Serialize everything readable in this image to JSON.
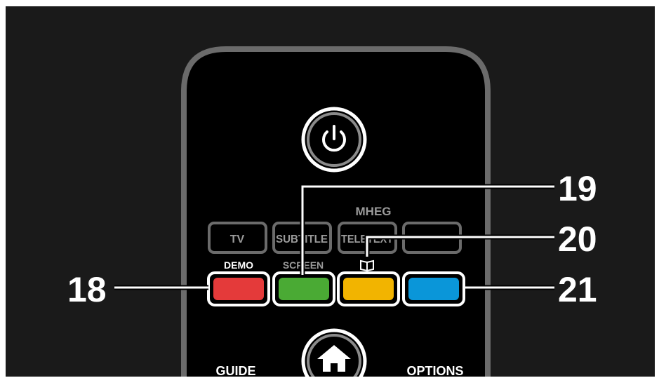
{
  "remote": {
    "power_icon": "power-icon",
    "home_icon": "home-icon",
    "book_icon": "book-icon",
    "top_buttons": [
      {
        "label": "TV"
      },
      {
        "label": "SUBTITLE"
      },
      {
        "label": "TELETEXT"
      },
      {
        "label": ""
      }
    ],
    "mheg_label": "MHEG",
    "color_button_labels": {
      "red": "DEMO",
      "green": "SCREEN"
    },
    "bottom_labels": {
      "guide": "GUIDE",
      "options": "OPTIONS"
    },
    "colors": {
      "background": "#1a1a1a",
      "body": "#000000",
      "outline": "#6b6b6b",
      "red": "#e43a3a",
      "green": "#4aaa34",
      "yellow": "#f2b400",
      "blue": "#0a96d9"
    }
  },
  "callouts": {
    "c18": "18",
    "c19": "19",
    "c20": "20",
    "c21": "21"
  }
}
